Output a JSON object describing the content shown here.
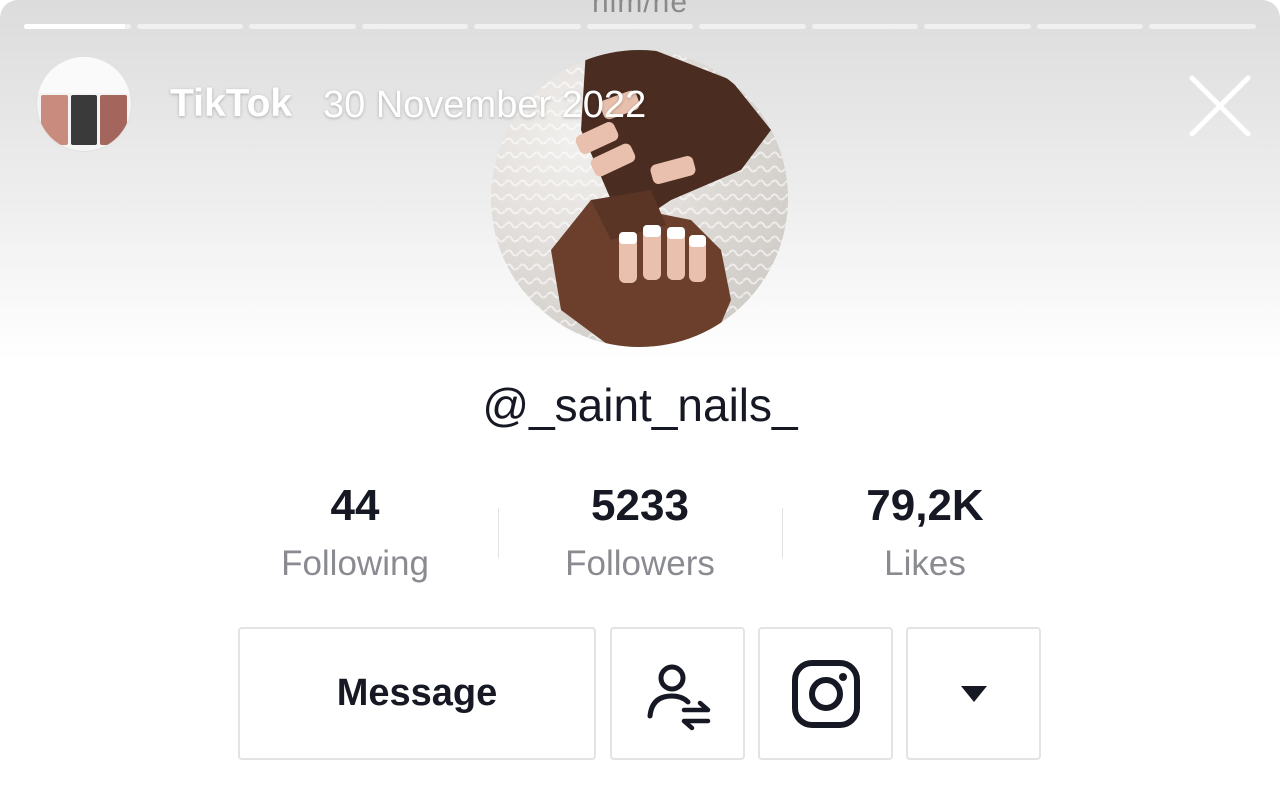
{
  "story": {
    "pronoun_text": "him/he",
    "progress_segments": 11,
    "active_segment_progress": 0.95,
    "source_title": "TikTok",
    "date": "30 November 2022",
    "close_icon": "close-icon"
  },
  "profile": {
    "username": "@_saint_nails_",
    "stats": [
      {
        "value": "44",
        "label": "Following"
      },
      {
        "value": "5233",
        "label": "Followers"
      },
      {
        "value": "79,2K",
        "label": "Likes"
      }
    ]
  },
  "actions": {
    "message_label": "Message",
    "follow_suggest_icon": "add-friends-swap-icon",
    "instagram_icon": "instagram-icon",
    "more_icon": "caret-down-icon"
  },
  "colors": {
    "text_primary": "#161823",
    "text_secondary": "#8a8b91",
    "border": "#e3e3e4"
  }
}
